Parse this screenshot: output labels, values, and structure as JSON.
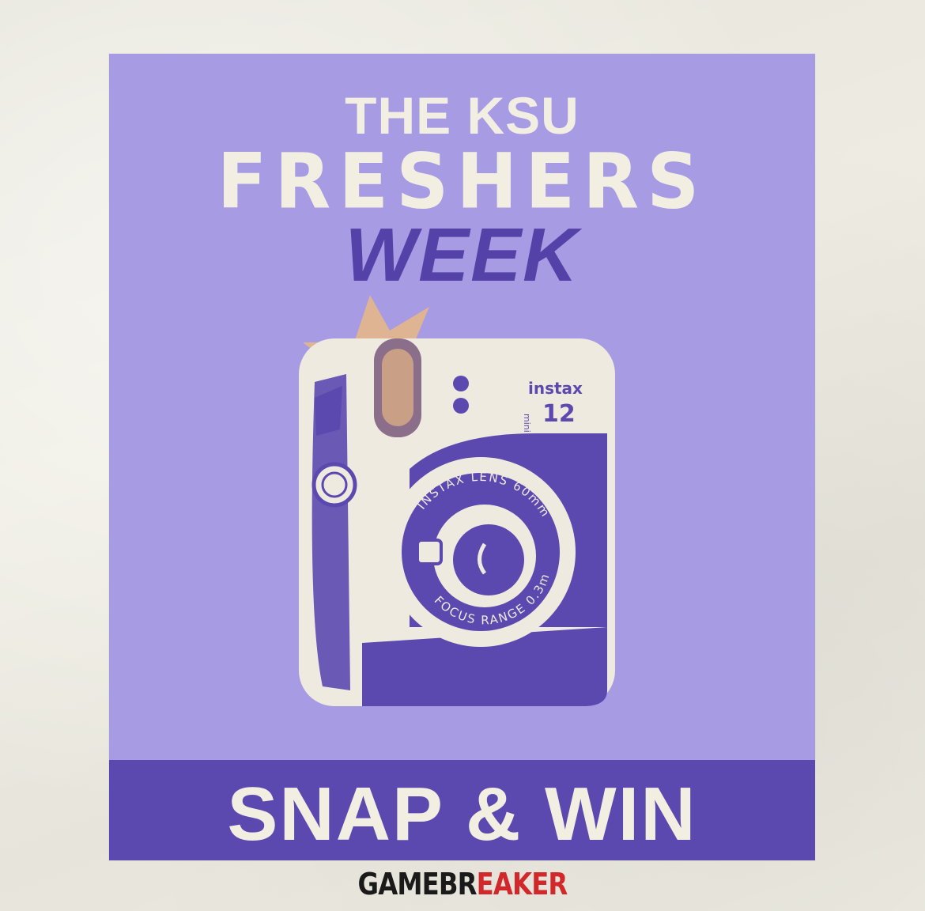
{
  "poster": {
    "title_line1": "THE KSU",
    "title_line2": "FRESHERS",
    "title_line3": "WEEK",
    "banner_text": "SNAP & WIN",
    "background_color": "#a79be4",
    "accent_color": "#5b49b0",
    "text_color": "#f2eee2"
  },
  "camera": {
    "brand": "instax",
    "model_prefix": "mini",
    "model_number": "12",
    "lens_top_text": "INSTAX LENS 60mm",
    "lens_bottom_text": "FOCUS RANGE 0.3m-",
    "flash_color": "#e9b884"
  },
  "footer": {
    "brand_part1": "GAMEBR",
    "brand_part2": "EAKER"
  }
}
